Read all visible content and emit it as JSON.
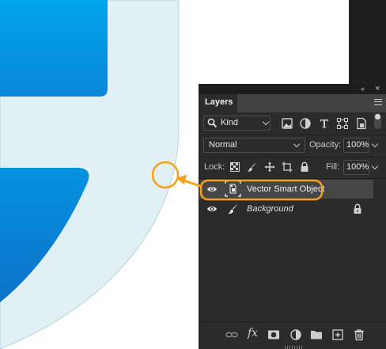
{
  "panel": {
    "tab_label": "Layers",
    "filter": {
      "label": "Kind"
    },
    "blend_mode": "Normal",
    "opacity_label": "Opacity:",
    "opacity_value": "100%",
    "lock_label": "Lock:",
    "fill_label": "Fill:",
    "fill_value": "100%",
    "layers": [
      {
        "name": "Vector Smart Object",
        "type": "smart-object",
        "visible": true,
        "selected": true
      },
      {
        "name": "Background",
        "type": "pixel",
        "visible": true,
        "locked": true
      }
    ],
    "bottom_icons": [
      "link-layers-icon",
      "fx-icon",
      "add-mask-icon",
      "adjustment-layer-icon",
      "new-group-icon",
      "new-layer-icon",
      "delete-layer-icon"
    ],
    "fx_text": "fx"
  },
  "colors": {
    "accent_annotation": "#f7a11a",
    "panel_bg": "#2b2b2b",
    "selected_row": "#464646",
    "canvas_blue_top": "#00a2e8",
    "canvas_blue_bottom": "#0f7fd4",
    "canvas_light": "#e0f0f5"
  }
}
